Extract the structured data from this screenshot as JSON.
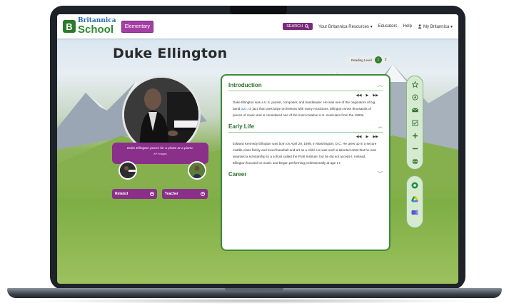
{
  "header": {
    "logo_brand": "Britannica",
    "logo_school": "School",
    "level_badge": "Elementary",
    "search_label": "SEARCH",
    "nav": [
      "Your Britannica Resources ▾",
      "Educators",
      "Help",
      "My Britannica ▾"
    ]
  },
  "page": {
    "title": "Duke Ellington",
    "reading_level_label": "Reading Level",
    "reading_level_options": [
      "1",
      "2"
    ]
  },
  "media": {
    "caption": "Duke Ellington poses for a photo at a piano.",
    "credit": "AP Images"
  },
  "side_buttons": {
    "related": "Related",
    "teacher": "Teacher"
  },
  "article": {
    "sections": [
      {
        "title": "Introduction",
        "paragraph_parts": [
          "Duke Ellington was a U.S. pianist, composer, and bandleader. He was one of the originators of big band ",
          "jazz",
          ", or jazz that uses large orchestras with many musicians. Ellington wrote thousands of pieces of music and is considered one of the most creative U.S. musicians from the 1900s."
        ]
      },
      {
        "title": "Early Life",
        "paragraph": "Edward Kennedy Ellington was born on April 29, 1899, in Washington, D.C. He grew up in a secure middle-class family and loved baseball and art as a child. He was such a talented artist that he was awarded a scholarship to a school called the Pratt Institute, but he did not accept it. Instead, Ellington focused on music and began performing professionally at age 17."
      },
      {
        "title": "Career"
      }
    ],
    "audio_controls": [
      "◀◀",
      "▶",
      "▶▶"
    ],
    "chevron_up": "︿",
    "chevron_down": "﹀"
  },
  "tools": {
    "rail_1": [
      "star-icon",
      "save-icon",
      "email-icon",
      "notes-icon",
      "zoom-in-icon",
      "zoom-out-icon",
      "translate-icon"
    ],
    "rail_2": [
      "google-classroom-icon",
      "google-drive-icon",
      "microsoft-teams-icon"
    ]
  },
  "colors": {
    "brand_green": "#2e8b2e",
    "brand_purple": "#8a2f8a",
    "card_border": "#3c8a3c"
  }
}
